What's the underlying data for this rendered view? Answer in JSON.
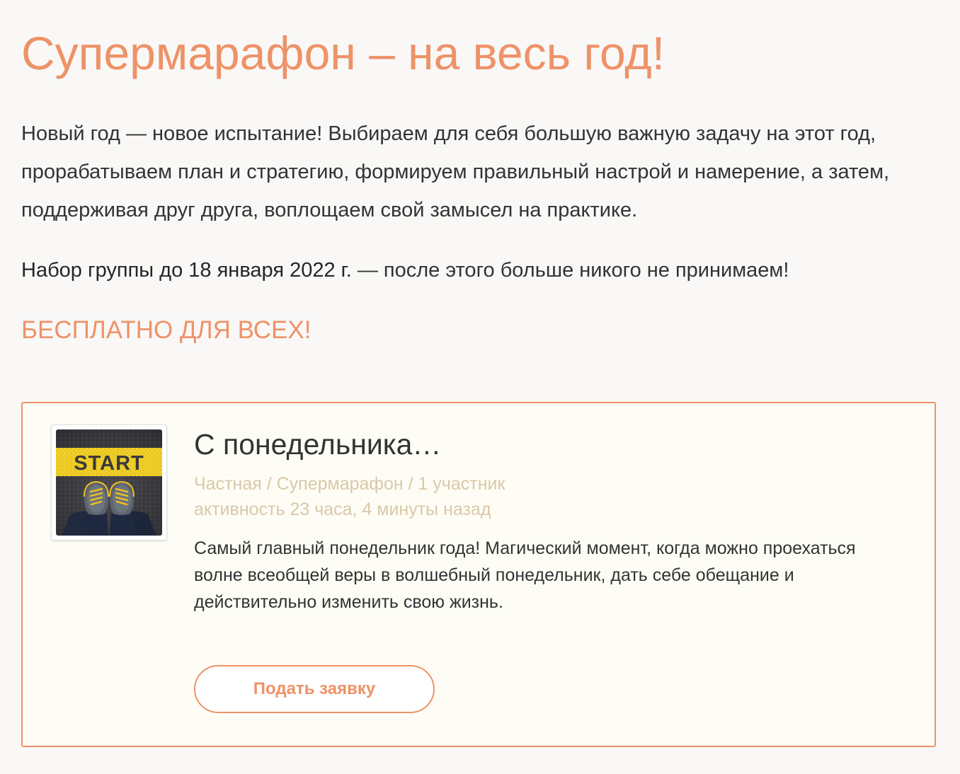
{
  "page": {
    "title": "Супермарафон – на весь год!",
    "intro": "Новый год — новое испытание! Выбираем для себя большую важную задачу на этот год, прорабатываем план и стратегию, формируем правильный настрой и намерение, а затем, поддерживая друг друга, воплощаем свой замысел на практике.",
    "deadline_bold": "Набор группы до 18 января 2022 г.",
    "deadline_rest": " — после этого больше никого не принимаем!",
    "free_label": "БЕСПЛАТНО ДЛЯ ВСЕХ!"
  },
  "group": {
    "title": "С понедельника…",
    "meta_line": "Частная / Супермарафон / 1 участник",
    "activity": "активность 23 часа, 4 минуты назад",
    "description": "Самый главный понедельник года! Магический момент, когда можно проехаться волне всеобщей веры в волшебный понедельник, дать себе обещание и действительно изменить свою жизнь.",
    "image_text": "START",
    "join_label": "Подать заявку"
  },
  "colors": {
    "accent": "#ee9268",
    "background": "#f9f8f6",
    "card_background": "#fefdf5",
    "meta": "#d9c8a9",
    "text": "#333333"
  }
}
